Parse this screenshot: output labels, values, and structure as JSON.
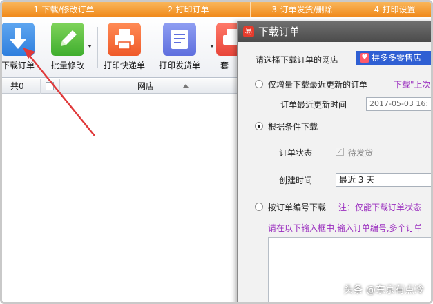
{
  "steps": [
    {
      "label": "1-下载/修改订单"
    },
    {
      "label": "2-打印订单"
    },
    {
      "label": "3-订单发货/删除"
    },
    {
      "label": "4-打印设置"
    }
  ],
  "toolbar": {
    "download_label": "下载订单",
    "batch_edit_label": "批量修改",
    "print_express_label": "打印快递单",
    "print_invoice_label": "打印发货单",
    "set_label": "套"
  },
  "grid": {
    "total_label": "共0",
    "shop_col": "网店"
  },
  "dialog": {
    "title": "下载订单",
    "select_shop_label": "请选择下载订单的网店",
    "shop_value": "拼多多零售店",
    "opt_recent_label": "仅增量下载最近更新的订单",
    "opt_recent_note": "下载\"上次",
    "last_update_label": "订单最近更新时间",
    "last_update_value": "2017-05-03 16:",
    "opt_condition_label": "根据条件下载",
    "order_status_label": "订单状态",
    "order_status_value": "待发货",
    "create_time_label": "创建时间",
    "create_time_value": "最近 3 天",
    "opt_by_number_label": "按订单编号下载",
    "opt_by_number_note": "注：仅能下载订单状态",
    "instruction": "请在以下输入框中,输入订单编号,多个订单"
  },
  "watermark": "头条 @东京有点冷",
  "colors": {
    "accent": "#f08a1c",
    "dialog_title": "#555555",
    "purple_text": "#9b2fbf",
    "arrow": "#e0393a"
  }
}
